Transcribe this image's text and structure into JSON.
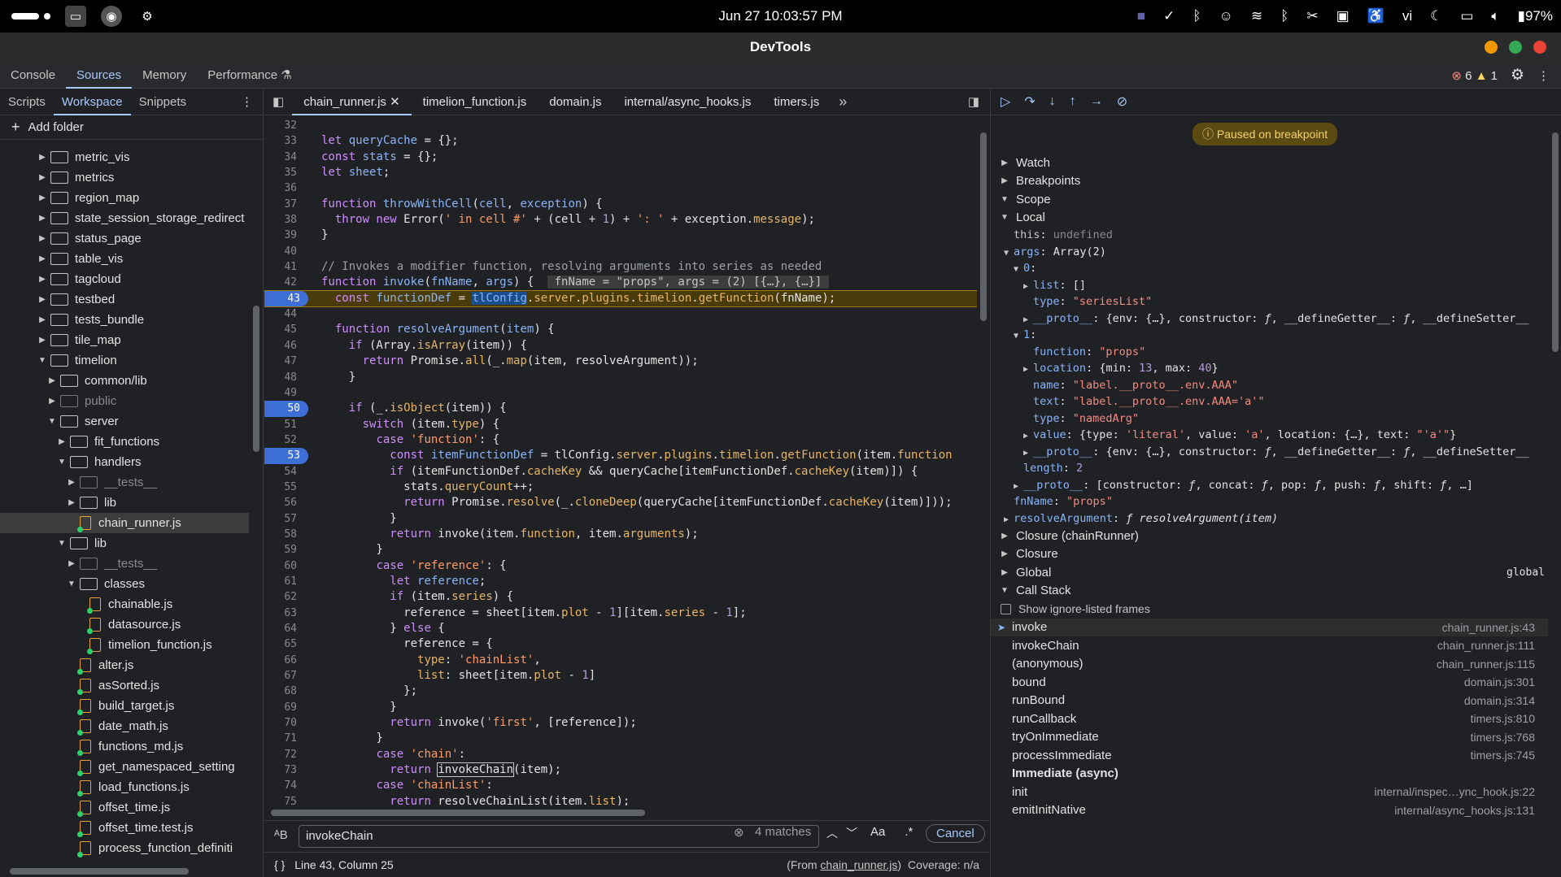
{
  "system": {
    "clock": "Jun 27  10:03:57 PM",
    "lang": "vi",
    "battery": "97%"
  },
  "window": {
    "title": "DevTools"
  },
  "main_tabs": [
    "Console",
    "Sources",
    "Memory",
    "Performance"
  ],
  "main_tabs_active": "Sources",
  "issues": {
    "errors": "6",
    "warnings": "1"
  },
  "left": {
    "tabs": [
      "Scripts",
      "Workspace",
      "Snippets"
    ],
    "add_folder": "Add folder",
    "tree": [
      {
        "label": "metric_vis",
        "type": "folder",
        "depth": 0,
        "open": false
      },
      {
        "label": "metrics",
        "type": "folder",
        "depth": 0,
        "open": false
      },
      {
        "label": "region_map",
        "type": "folder",
        "depth": 0,
        "open": false
      },
      {
        "label": "state_session_storage_redirect",
        "type": "folder",
        "depth": 0,
        "open": false
      },
      {
        "label": "status_page",
        "type": "folder",
        "depth": 0,
        "open": false
      },
      {
        "label": "table_vis",
        "type": "folder",
        "depth": 0,
        "open": false
      },
      {
        "label": "tagcloud",
        "type": "folder",
        "depth": 0,
        "open": false
      },
      {
        "label": "testbed",
        "type": "folder",
        "depth": 0,
        "open": false
      },
      {
        "label": "tests_bundle",
        "type": "folder",
        "depth": 0,
        "open": false
      },
      {
        "label": "tile_map",
        "type": "folder",
        "depth": 0,
        "open": false
      },
      {
        "label": "timelion",
        "type": "folder",
        "depth": 0,
        "open": true
      },
      {
        "label": "common/lib",
        "type": "folder",
        "depth": 1,
        "open": false
      },
      {
        "label": "public",
        "type": "folder",
        "depth": 1,
        "open": false,
        "dim": true
      },
      {
        "label": "server",
        "type": "folder",
        "depth": 1,
        "open": true
      },
      {
        "label": "fit_functions",
        "type": "folder",
        "depth": 2,
        "open": false
      },
      {
        "label": "handlers",
        "type": "folder",
        "depth": 2,
        "open": true
      },
      {
        "label": "__tests__",
        "type": "folder",
        "depth": 3,
        "open": false,
        "dim": true
      },
      {
        "label": "lib",
        "type": "folder",
        "depth": 3,
        "open": false
      },
      {
        "label": "chain_runner.js",
        "type": "file",
        "depth": 3,
        "selected": true
      },
      {
        "label": "lib",
        "type": "folder",
        "depth": 2,
        "open": true
      },
      {
        "label": "__tests__",
        "type": "folder",
        "depth": 3,
        "open": false,
        "dim": true
      },
      {
        "label": "classes",
        "type": "folder",
        "depth": 3,
        "open": true
      },
      {
        "label": "chainable.js",
        "type": "file",
        "depth": 4
      },
      {
        "label": "datasource.js",
        "type": "file",
        "depth": 4
      },
      {
        "label": "timelion_function.js",
        "type": "file",
        "depth": 4
      },
      {
        "label": "alter.js",
        "type": "file",
        "depth": 3
      },
      {
        "label": "asSorted.js",
        "type": "file",
        "depth": 3
      },
      {
        "label": "build_target.js",
        "type": "file",
        "depth": 3
      },
      {
        "label": "date_math.js",
        "type": "file",
        "depth": 3
      },
      {
        "label": "functions_md.js",
        "type": "file",
        "depth": 3
      },
      {
        "label": "get_namespaced_setting",
        "type": "file",
        "depth": 3
      },
      {
        "label": "load_functions.js",
        "type": "file",
        "depth": 3
      },
      {
        "label": "offset_time.js",
        "type": "file",
        "depth": 3
      },
      {
        "label": "offset_time.test.js",
        "type": "file",
        "depth": 3
      },
      {
        "label": "process_function_definiti",
        "type": "file",
        "depth": 3
      }
    ]
  },
  "editor": {
    "tabs": [
      "chain_runner.js",
      "timelion_function.js",
      "domain.js",
      "internal/async_hooks.js",
      "timers.js"
    ],
    "active_tab": "chain_runner.js",
    "lines": [
      {
        "n": "32",
        "html": ""
      },
      {
        "n": "33",
        "html": "<span class='kw'>let</span> <span class='fn'>queryCache</span> = {};"
      },
      {
        "n": "34",
        "html": "<span class='kw'>const</span> <span class='fn'>stats</span> = {};"
      },
      {
        "n": "35",
        "html": "<span class='kw'>let</span> <span class='fn'>sheet</span>;"
      },
      {
        "n": "36",
        "html": ""
      },
      {
        "n": "37",
        "html": "<span class='kw'>function</span> <span class='fn'>throwWithCell</span>(<span class='fn'>cell</span>, <span class='fn'>exception</span>) {"
      },
      {
        "n": "38",
        "html": "  <span class='kw'>throw new</span> Error(<span class='st'>' in cell #'</span> + (cell + <span class='nm'>1</span>) + <span class='st'>': '</span> + exception.<span class='pr'>message</span>);"
      },
      {
        "n": "39",
        "html": "}"
      },
      {
        "n": "40",
        "html": ""
      },
      {
        "n": "41",
        "html": "<span class='cm'>// Invokes a modifier function, resolving arguments into series as needed</span>"
      },
      {
        "n": "42",
        "html": "<span class='kw'>function</span> <span class='fn'>invoke</span>(<span class='fn'>fnName</span>, <span class='fn'>args</span>) {  <span style='background:#3c3c3c;color:#c4c7c5'> fnName = \"props\", args = (2) [{…}, {…}] </span>"
      },
      {
        "n": "43",
        "html": "  <span class='kw'>const</span> <span class='fn'>functionDef</span> = <span style='background:#1a4d8c;color:#8ab4f8'>tlConfig</span>.<span class='pr'>server</span>.<span class='pr'>plugins</span>.<span class='pr'>timelion</span>.<span class='pr'>getFunction</span>(fnName);",
        "bp": true,
        "cur": true
      },
      {
        "n": "44",
        "html": ""
      },
      {
        "n": "45",
        "html": "  <span class='kw'>function</span> <span class='fn'>resolveArgument</span>(<span class='fn'>item</span>) {"
      },
      {
        "n": "46",
        "html": "    <span class='kw'>if</span> (Array.<span class='pr'>isArray</span>(item)) {"
      },
      {
        "n": "47",
        "html": "      <span class='kw'>return</span> Promise.<span class='pr'>all</span>(_.<span class='pr'>map</span>(item, resolveArgument));"
      },
      {
        "n": "48",
        "html": "    }"
      },
      {
        "n": "49",
        "html": ""
      },
      {
        "n": "50",
        "html": "    <span class='kw'>if</span> (_.<span class='pr'>isObject</span>(item)) {",
        "bp": true
      },
      {
        "n": "51",
        "html": "      <span class='kw'>switch</span> (item.<span class='pr'>type</span>) {"
      },
      {
        "n": "52",
        "html": "        <span class='kw'>case</span> <span class='st'>'function'</span>: {"
      },
      {
        "n": "53",
        "html": "          <span class='kw'>const</span> <span class='fn'>itemFunctionDef</span> = tlConfig.<span class='pr'>server</span>.<span class='pr'>plugins</span>.<span class='pr'>timelion</span>.<span class='pr'>getFunction</span>(item.<span class='pr'>function</span>",
        "bp": true
      },
      {
        "n": "54",
        "html": "          <span class='kw'>if</span> (itemFunctionDef.<span class='pr'>cacheKey</span> &amp;&amp; queryCache[itemFunctionDef.<span class='pr'>cacheKey</span>(item)]) {"
      },
      {
        "n": "55",
        "html": "            stats.<span class='pr'>queryCount</span>++;"
      },
      {
        "n": "56",
        "html": "            <span class='kw'>return</span> Promise.<span class='pr'>resolve</span>(_.<span class='pr'>cloneDeep</span>(queryCache[itemFunctionDef.<span class='pr'>cacheKey</span>(item)]));"
      },
      {
        "n": "57",
        "html": "          }"
      },
      {
        "n": "58",
        "html": "          <span class='kw'>return</span> invoke(item.<span class='pr'>function</span>, item.<span class='pr'>arguments</span>);"
      },
      {
        "n": "59",
        "html": "        }"
      },
      {
        "n": "60",
        "html": "        <span class='kw'>case</span> <span class='st'>'reference'</span>: {"
      },
      {
        "n": "61",
        "html": "          <span class='kw'>let</span> <span class='fn'>reference</span>;"
      },
      {
        "n": "62",
        "html": "          <span class='kw'>if</span> (item.<span class='pr'>series</span>) {"
      },
      {
        "n": "63",
        "html": "            reference = sheet[item.<span class='pr'>plot</span> - <span class='nm'>1</span>][item.<span class='pr'>series</span> - <span class='nm'>1</span>];"
      },
      {
        "n": "64",
        "html": "          } <span class='kw'>else</span> {"
      },
      {
        "n": "65",
        "html": "            reference = {"
      },
      {
        "n": "66",
        "html": "              <span class='pr'>type</span>: <span class='st'>'chainList'</span>,"
      },
      {
        "n": "67",
        "html": "              <span class='pr'>list</span>: sheet[item.<span class='pr'>plot</span> - <span class='nm'>1</span>]"
      },
      {
        "n": "68",
        "html": "            };"
      },
      {
        "n": "69",
        "html": "          }"
      },
      {
        "n": "70",
        "html": "          <span class='kw'>return</span> invoke(<span class='st'>'first'</span>, [reference]);"
      },
      {
        "n": "71",
        "html": "        }"
      },
      {
        "n": "72",
        "html": "        <span class='kw'>case</span> <span class='st'>'chain'</span>:"
      },
      {
        "n": "73",
        "html": "          <span class='kw'>return</span> <span style='outline:1px solid #c4c7c5'>invokeChain</span>(item);"
      },
      {
        "n": "74",
        "html": "        <span class='kw'>case</span> <span class='st'>'chainList'</span>:"
      },
      {
        "n": "75",
        "html": "          <span class='kw'>return</span> resolveChainList(item.<span class='pr'>list</span>);"
      }
    ],
    "search": {
      "value": "invokeChain",
      "matches": "4 matches",
      "case_label": "Aa",
      "regex_label": ".*",
      "cancel": "Cancel"
    },
    "status": {
      "position": "Line 43, Column 25",
      "from_prefix": "(From ",
      "from_file": "chain_runner.js",
      "from_suffix": ")",
      "coverage": "Coverage: n/a"
    }
  },
  "debugger": {
    "paused": "Paused on breakpoint",
    "sections": {
      "watch": "Watch",
      "breakpoints": "Breakpoints",
      "scope": "Scope",
      "local": "Local",
      "closure_chain": "Closure (chainRunner)",
      "closure": "Closure",
      "global": "Global",
      "global_value": "global",
      "call_stack": "Call Stack"
    },
    "scope_lines": [
      {
        "indent": 28,
        "html": "<span class='sval'>this</span>: <span class='sval' style='color:#8a8a8a'>undefined</span>"
      },
      {
        "indent": 16,
        "tri": "▼",
        "html": "<span class='key'>args</span>: Array(2)"
      },
      {
        "indent": 28,
        "tri": "▼",
        "html": "<span class='key'>0</span>:"
      },
      {
        "indent": 40,
        "tri": "▶",
        "html": "<span class='key'>list</span>: []"
      },
      {
        "indent": 52,
        "html": "<span class='key'>type</span>: <span class='ss'>\"seriesList\"</span>"
      },
      {
        "indent": 40,
        "tri": "▶",
        "html": "<span class='key'>__proto__</span>: {env: {…}, constructor: <i>ƒ</i>, __defineGetter__: <i>ƒ</i>, __defineSetter__"
      },
      {
        "indent": 28,
        "tri": "▼",
        "html": "<span class='key'>1</span>:"
      },
      {
        "indent": 52,
        "html": "<span class='key'>function</span>: <span class='ss'>\"props\"</span>"
      },
      {
        "indent": 40,
        "tri": "▶",
        "html": "<span class='key'>location</span>: {min: <span class='sn'>13</span>, max: <span class='sn'>40</span>}"
      },
      {
        "indent": 52,
        "html": "<span class='key'>name</span>: <span class='ss'>\"label.__proto__.env.AAA\"</span>"
      },
      {
        "indent": 52,
        "html": "<span class='key'>text</span>: <span class='ss'>\"label.__proto__.env.AAA='a'\"</span>"
      },
      {
        "indent": 52,
        "html": "<span class='key'>type</span>: <span class='ss'>\"namedArg\"</span>"
      },
      {
        "indent": 40,
        "tri": "▶",
        "html": "<span class='key'>value</span>: {type: <span class='ss'>'literal'</span>, value: <span class='ss'>'a'</span>, location: {…}, text: <span class='ss'>\"'a'\"</span>}"
      },
      {
        "indent": 40,
        "tri": "▶",
        "html": "<span class='key'>__proto__</span>: {env: {…}, constructor: <i>ƒ</i>, __defineGetter__: <i>ƒ</i>, __defineSetter__"
      },
      {
        "indent": 40,
        "html": "<span class='key'>length</span>: <span class='sn'>2</span>"
      },
      {
        "indent": 28,
        "tri": "▶",
        "html": "<span class='key'>__proto__</span>: [constructor: <i>ƒ</i>, concat: <i>ƒ</i>, pop: <i>ƒ</i>, push: <i>ƒ</i>, shift: <i>ƒ</i>, …]"
      },
      {
        "indent": 28,
        "html": "<span class='key'>fnName</span>: <span class='ss'>\"props\"</span>"
      },
      {
        "indent": 16,
        "tri": "▶",
        "html": "<span class='key'>resolveArgument</span>: <i>ƒ resolveArgument(item)</i>"
      }
    ],
    "show_ignore": "Show ignore-listed frames",
    "frames": [
      {
        "name": "invoke",
        "loc": "chain_runner.js:43",
        "active": true
      },
      {
        "name": "invokeChain",
        "loc": "chain_runner.js:111"
      },
      {
        "name": "(anonymous)",
        "loc": "chain_runner.js:115"
      },
      {
        "name": "bound",
        "loc": "domain.js:301"
      },
      {
        "name": "runBound",
        "loc": "domain.js:314"
      },
      {
        "name": "runCallback",
        "loc": "timers.js:810"
      },
      {
        "name": "tryOnImmediate",
        "loc": "timers.js:768"
      },
      {
        "name": "processImmediate",
        "loc": "timers.js:745"
      },
      {
        "name": "Immediate (async)",
        "loc": "",
        "async": true
      },
      {
        "name": "init",
        "loc": "internal/inspec…ync_hook.js:22"
      },
      {
        "name": "emitInitNative",
        "loc": "internal/async_hooks.js:131"
      }
    ]
  },
  "colors": {
    "accent": "#a8c7fa",
    "breakpoint": "#3e6fd6",
    "paused_bg": "#5b4a12",
    "close": "#ea4335",
    "minimize": "#f29900",
    "maximize": "#34a853"
  }
}
